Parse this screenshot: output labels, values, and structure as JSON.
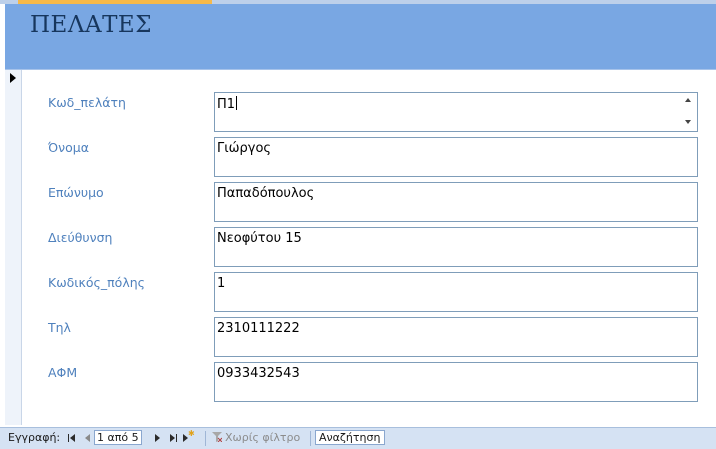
{
  "form": {
    "title": "ΠΕΛΑΤΕΣ"
  },
  "fields": [
    {
      "label": "Κωδ_πελάτη",
      "value": "Π1"
    },
    {
      "label": "Όνομα",
      "value": "Γιώργος"
    },
    {
      "label": "Επώνυμο",
      "value": "Παπαδόπουλος"
    },
    {
      "label": "Διεύθυνση",
      "value": "Νεοφύτου 15"
    },
    {
      "label": "Κωδικός_πόλης",
      "value": "1"
    },
    {
      "label": "Τηλ",
      "value": "2310111222"
    },
    {
      "label": "ΑΦΜ",
      "value": "0933432543"
    }
  ],
  "navigation": {
    "record_label": "Εγγραφή:",
    "record_position": "1 από 5",
    "filter_label": "Χωρίς φίλτρο",
    "search_placeholder": "Αναζήτηση"
  },
  "colors": {
    "header_bg": "#79a7e3",
    "title_text": "#17365d",
    "label_text": "#4f81bd",
    "field_border": "#7f9db9",
    "navbar_bg": "#d5e2f3"
  },
  "icons": {
    "record_selector": "record-selector-arrow-icon",
    "nav_first": "first-record-icon",
    "nav_prev": "previous-record-icon",
    "nav_next": "next-record-icon",
    "nav_last": "last-record-icon",
    "nav_new": "new-record-icon",
    "filter": "filter-icon"
  }
}
